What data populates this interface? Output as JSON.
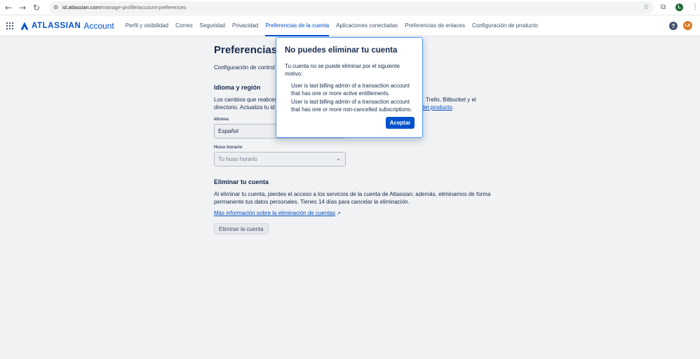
{
  "browser": {
    "url_host": "id.atlassian.com",
    "url_path": "/manage-profile/account-preferences",
    "profile_initial": "L"
  },
  "header": {
    "logo_text": "ATLASSIAN",
    "logo_sub": "Account",
    "nav_items": [
      {
        "label": "Perfil y visibilidad",
        "active": false
      },
      {
        "label": "Correo",
        "active": false
      },
      {
        "label": "Seguridad",
        "active": false
      },
      {
        "label": "Privacidad",
        "active": false
      },
      {
        "label": "Preferencias de la cuenta",
        "active": true
      },
      {
        "label": "Aplicaciones conectadas",
        "active": false
      },
      {
        "label": "Preferencias de enlaces",
        "active": false
      },
      {
        "label": "Configuración de producto",
        "active": false
      }
    ],
    "help_glyph": "?",
    "avatar_initials": "LA"
  },
  "main": {
    "title_visible": "Preferencias de",
    "intro_visible": "Configuración de control",
    "language_section": {
      "title": "Idioma y región",
      "para_line1_left": "Los cambios que realices",
      "para_line1_right": "Trello, Bitbucket y el",
      "para_line2_left": "directorio. Actualiza tu id",
      "para_line2_link": "n del producto",
      "para_line2_end": ".",
      "language_label": "Idioma",
      "language_value": "Español",
      "timezone_label": "Huso horario",
      "timezone_placeholder": "Tu huso horario"
    },
    "delete_section": {
      "title": "Eliminar tu cuenta",
      "para_line1": "Al eliminar tu cuenta, pierdes el acceso a los servicios de la cuenta de Atlassian; además, eliminamos de forma",
      "para_line2": "permanente tus datos personales. Tienes 14 días para cancelar la eliminación.",
      "link": "Más información sobre la eliminación de cuentas",
      "button": "Eliminar la cuenta"
    }
  },
  "modal": {
    "title": "No puedes eliminar tu cuenta",
    "body": "Tu cuenta no se puede eliminar por el siguiente motivo:",
    "reasons": [
      "User is last billing admin of a transaction account that has one or more active entitlements.",
      "User is last billing admin of a transaction account that has one or more non-cancelled subscriptions."
    ],
    "accept": "Aceptar"
  },
  "colors": {
    "brand": "#0052cc",
    "text": "#172b4d",
    "modal_border": "#4c9aff"
  },
  "icons": [
    "back-arrow-icon",
    "forward-arrow-icon",
    "reload-icon",
    "site-settings-icon",
    "star-icon",
    "extensions-icon",
    "more-icon",
    "app-switcher-icon",
    "atlassian-logo-icon",
    "help-icon",
    "chevron-down-icon",
    "external-link-icon"
  ]
}
